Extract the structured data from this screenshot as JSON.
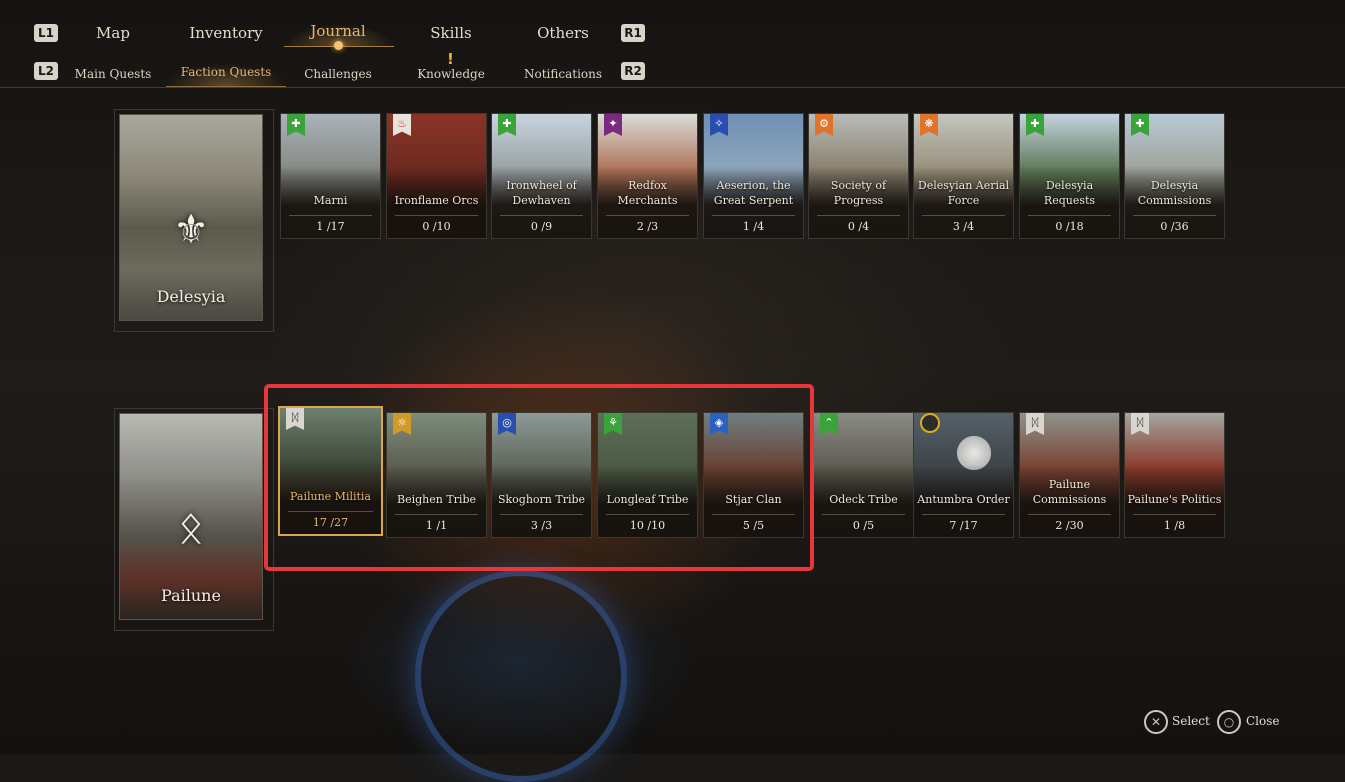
{
  "nav": {
    "left_bumper": "L1",
    "right_bumper": "R1",
    "left_trigger": "L2",
    "right_trigger": "R2",
    "tabs": [
      {
        "label": "Map"
      },
      {
        "label": "Inventory"
      },
      {
        "label": "Journal",
        "active": true
      },
      {
        "label": "Skills"
      },
      {
        "label": "Others"
      }
    ],
    "subtabs": [
      {
        "label": "Main Quests"
      },
      {
        "label": "Faction Quests",
        "active": true
      },
      {
        "label": "Challenges"
      },
      {
        "label": "Knowledge",
        "alert": "!"
      },
      {
        "label": "Notifications"
      }
    ]
  },
  "regions": [
    {
      "name": "Delesyia",
      "emblem": "fleur-de-lis-icon",
      "factions": [
        {
          "name": "Marni",
          "count": "1 /17",
          "flag_color": "#3aa43a",
          "icon": "cross-leaf-icon"
        },
        {
          "name": "Ironflame Orcs",
          "count": "0 /10",
          "flag_color": "#b8322f",
          "icon": "flame-icon"
        },
        {
          "name": "Ironwheel of Dewhaven",
          "count": "0 /9",
          "flag_color": "#3aa43a",
          "icon": "cross-leaf-icon"
        },
        {
          "name": "Redfox Merchants",
          "count": "2 /3",
          "flag_color": "#7a2a80",
          "icon": "fox-icon"
        },
        {
          "name": "Aeserion, the Great Serpent",
          "count": "1 /4",
          "flag_color": "#2a4eb0",
          "icon": "serpent-icon"
        },
        {
          "name": "Society of Progress",
          "count": "0 /4",
          "flag_color": "#e0742a",
          "icon": "gear-icon"
        },
        {
          "name": "Delesyian Aerial Force",
          "count": "3 /4",
          "flag_color": "#e0742a",
          "icon": "wing-icon"
        },
        {
          "name": "Delesyia Requests",
          "count": "0 /18",
          "flag_color": "#3aa43a",
          "icon": "cross-leaf-icon"
        },
        {
          "name": "Delesyia Commissions",
          "count": "0 /36",
          "flag_color": "#3aa43a",
          "icon": "cross-leaf-icon"
        }
      ]
    },
    {
      "name": "Pailune",
      "emblem": "wolf-knot-icon",
      "factions": [
        {
          "name": "Pailune Militia",
          "count": "17 /27",
          "flag_color": "#d8d6d0",
          "icon": "wolf-icon",
          "selected": true
        },
        {
          "name": "Beighen Tribe",
          "count": "1 /1",
          "flag_color": "#d09a2a",
          "icon": "sun-icon"
        },
        {
          "name": "Skoghorn Tribe",
          "count": "3 /3",
          "flag_color": "#2a4eb0",
          "icon": "circle-rune-icon"
        },
        {
          "name": "Longleaf Tribe",
          "count": "10 /10",
          "flag_color": "#3aa43a",
          "icon": "tree-icon"
        },
        {
          "name": "Stjar Clan",
          "count": "5 /5",
          "flag_color": "#2a62c0",
          "icon": "diamond-rune-icon"
        },
        {
          "name": "Odeck Tribe",
          "count": "0 /5",
          "flag_color": "#3aa43a",
          "icon": "chevron-icon"
        },
        {
          "name": "Antumbra Order",
          "count": "7 /17",
          "flag_color": "#d4b01a",
          "icon": "eclipse-icon"
        },
        {
          "name": "Pailune Commissions",
          "count": "2 /30",
          "flag_color": "#d8d6d0",
          "icon": "wolf-icon"
        },
        {
          "name": "Pailune's Politics",
          "count": "1 /8",
          "flag_color": "#d8d6d0",
          "icon": "wolf-icon"
        }
      ]
    }
  ],
  "footer": {
    "select_label": "Select",
    "close_label": "Close"
  },
  "colors": {
    "accent": "#e8b870",
    "highlight": "#e8373b"
  }
}
